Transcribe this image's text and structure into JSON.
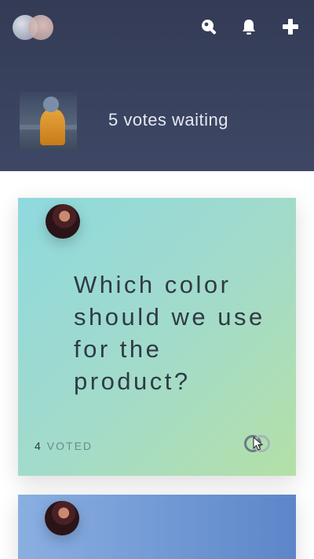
{
  "header": {
    "logo": "overlapping-circles-logo",
    "icons": [
      "search-icon",
      "bell-icon",
      "plus-icon"
    ],
    "waiting_text": "5 votes waiting"
  },
  "cards": [
    {
      "question": "Which color should we use for the product?",
      "voted_count": "4",
      "voted_label": "VOTED"
    },
    {
      "question": ""
    }
  ],
  "colors": {
    "header_bg": "#363e5a",
    "card1_gradient": [
      "#8fd9de",
      "#b4e0a6"
    ],
    "card2_gradient": [
      "#8aafe1",
      "#5c86c9"
    ],
    "text_dark": "#303a45"
  }
}
